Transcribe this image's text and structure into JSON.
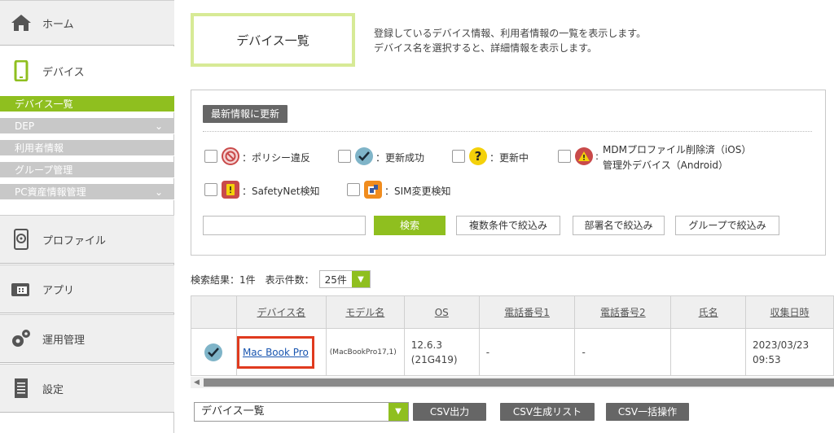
{
  "sidebar": {
    "home": "ホーム",
    "devices": "デバイス",
    "sub": [
      {
        "label": "デバイス一覧",
        "active": true,
        "chevron": false
      },
      {
        "label": "DEP",
        "active": false,
        "chevron": true
      },
      {
        "label": "利用者情報",
        "active": false,
        "chevron": false
      },
      {
        "label": "グループ管理",
        "active": false,
        "chevron": false
      },
      {
        "label": "PC資産情報管理",
        "active": false,
        "chevron": true
      }
    ],
    "profile": "プロファイル",
    "apps": "アプリ",
    "ops": "運用管理",
    "settings": "設定"
  },
  "page": {
    "title": "デバイス一覧",
    "desc1": "登録しているデバイス情報、利用者情報の一覧を表示します。",
    "desc2": "デバイス名を選択すると、詳細情報を表示します。"
  },
  "filter": {
    "refresh": "最新情報に更新",
    "legend": {
      "policy": "：ポリシー違反",
      "success": "：更新成功",
      "updating": "：更新中",
      "mdm1": "MDMプロファイル削除済（iOS）",
      "mdm2": "管理外デバイス（Android）",
      "safetynet": "：SafetyNet検知",
      "sim": "：SIM変更検知"
    },
    "search": "検索",
    "multi": "複数条件で絞込み",
    "dept": "部署名で絞込み",
    "group": "グループで絞込み",
    "search_value": ""
  },
  "results": {
    "count": "検索結果：1件",
    "per_page_label": "表示件数：",
    "per_page": "25件"
  },
  "table": {
    "headers": [
      "デバイス名",
      "モデル名",
      "OS",
      "電話番号1",
      "電話番号2",
      "氏名",
      "収集日時"
    ],
    "row": {
      "name": "Mac Book Pro",
      "model": "(MacBookPro17,1)",
      "os1": "12.6.3",
      "os2": "(21G419)",
      "tel1": "-",
      "tel2": "-",
      "person": "",
      "date1": "2023/03/23",
      "date2": "09:53"
    }
  },
  "bottom": {
    "select": "デバイス一覧",
    "csv_out": "CSV出力",
    "csv_list": "CSV生成リスト",
    "csv_bulk": "CSV一括操作"
  },
  "colors": {
    "accent": "#8fbf1f",
    "title_border": "#d7ea96",
    "highlight": "#e03a1e"
  }
}
